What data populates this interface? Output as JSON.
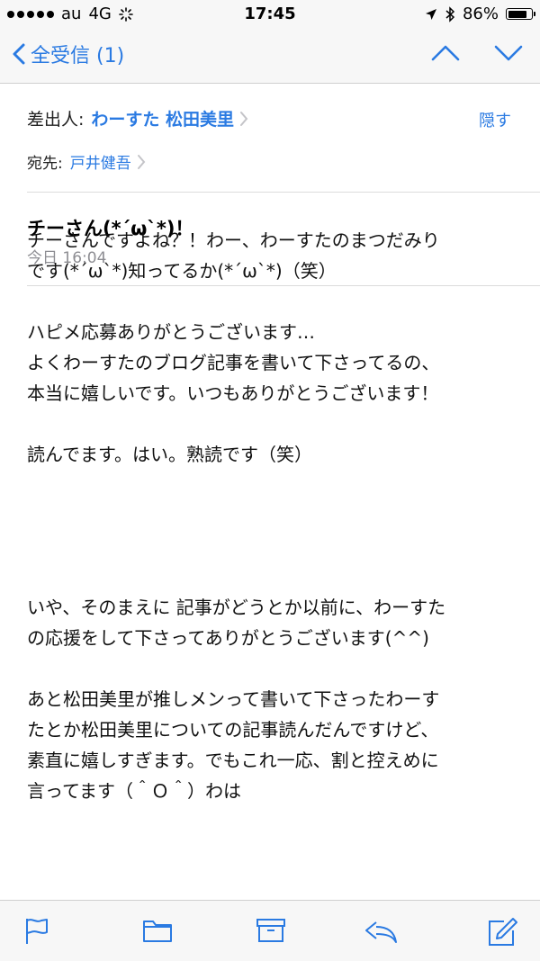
{
  "status": {
    "carrier": "au",
    "network": "4G",
    "time": "17:45",
    "battery": "86%",
    "battery_level": 0.86
  },
  "nav": {
    "back_label": "全受信 (1)"
  },
  "header": {
    "from_label": "差出人:",
    "from_name": "わーすた 松田美里",
    "hide_label": "隠す",
    "to_label": "宛先:",
    "to_name": "戸井健吾",
    "subject": "チーさん(*´ω`*)！",
    "date": "今日 16:04"
  },
  "body": {
    "p1_line1": "チーさんですよね？！わー、わーすたのまつだみり",
    "p1_line2": "です(*´ω`*)知ってるか(*´ω`*)（笑）",
    "p2_line1": "ハピメ応募ありがとうございます…",
    "p2_line2": "よくわーすたのブログ記事を書いて下さってるの、",
    "p2_line3": "本当に嬉しいです。いつもありがとうございます！",
    "p3_line1": "読んでます。はい。熟読です（笑）",
    "p4_line1": "いや、そのまえに 記事がどうとか以前に、わーすた",
    "p4_line2": "の応援をして下さってありがとうございます(^^)",
    "p5_line1": "あと松田美里が推しメンって書いて下さったわーす",
    "p5_line2": "たとか松田美里についての記事読んだんですけど、",
    "p5_line3": "素直に嬉しすぎます。でもこれ一応、割と控えめに",
    "p5_line4": "言ってます（＾Ｏ＾）わは"
  },
  "colors": {
    "accent": "#2a7ae2",
    "secondary_text": "#8e8e93"
  }
}
